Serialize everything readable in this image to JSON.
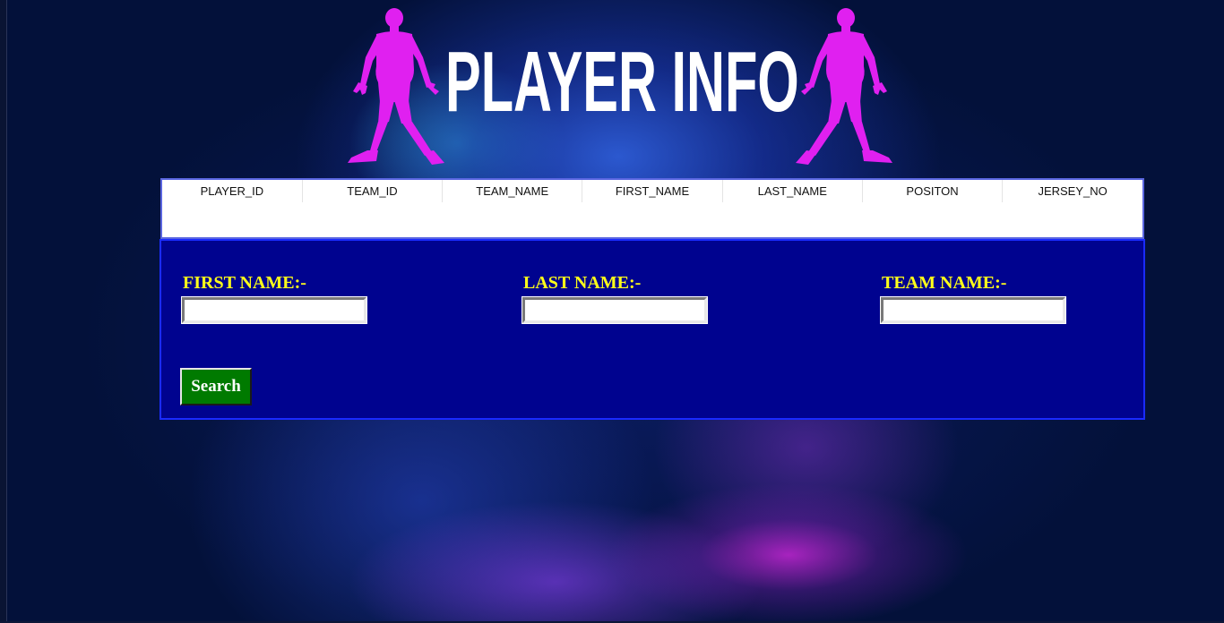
{
  "page": {
    "title": "PLAYER INFO",
    "colors": {
      "background": "#03113a",
      "title": "#ffffff",
      "silhouette": "#e020f0",
      "panel": "#00038f",
      "label": "#ffff1a",
      "search_button": "#007a00"
    }
  },
  "header": {
    "left_icon": "soccer-player-silhouette-icon",
    "right_icon": "soccer-player-silhouette-icon"
  },
  "results_table": {
    "columns": [
      "PLAYER_ID",
      "TEAM_ID",
      "TEAM_NAME",
      "FIRST_NAME",
      "LAST_NAME",
      "POSITON",
      "JERSEY_NO"
    ],
    "rows": []
  },
  "search_form": {
    "first_name": {
      "label": "FIRST NAME:-",
      "value": ""
    },
    "last_name": {
      "label": "LAST NAME:-",
      "value": ""
    },
    "team_name": {
      "label": "TEAM NAME:-",
      "value": ""
    },
    "search_button": "Search"
  }
}
